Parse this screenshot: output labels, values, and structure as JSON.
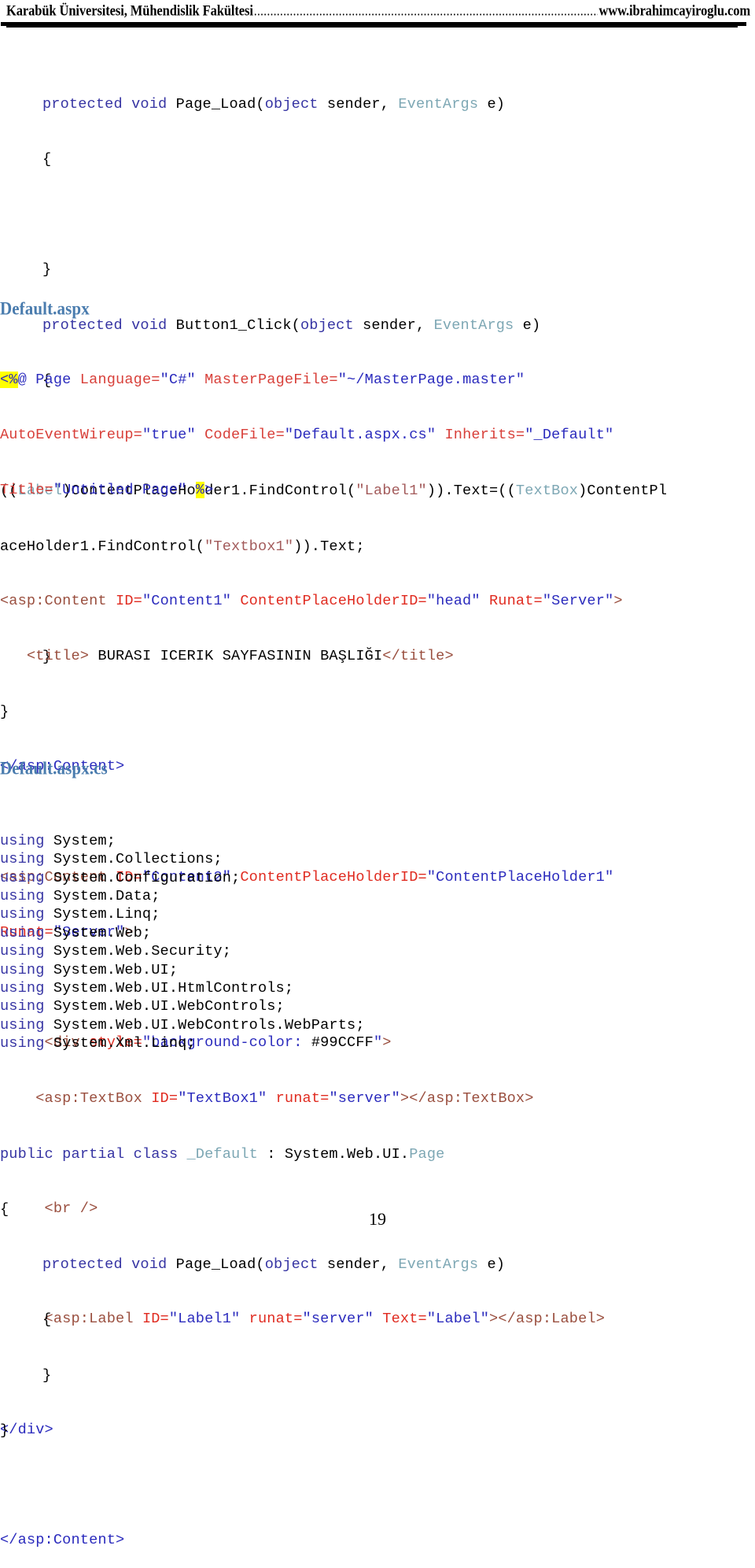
{
  "header": {
    "left": "Karabük Üniversitesi, Mühendislik Fakültesi",
    "dots": "............................................................................................................",
    "right": "www.ibrahimcayiroglu.com"
  },
  "headings": {
    "default_aspx": "Default.aspx",
    "default_aspx_cs": "Default.aspx.cs"
  },
  "code_top": {
    "l1_kw": "protected void",
    "l1_name": " Page_Load(",
    "l1_obj": "object",
    "l1_mid": " sender, ",
    "l1_type": "EventArgs",
    "l1_end": " e)",
    "l2": "{",
    "l3": "}",
    "l4_kw": "protected void",
    "l4_name": " Button1_Click(",
    "l4_obj": "object",
    "l4_mid": " sender, ",
    "l4_type": "EventArgs",
    "l4_end": " e)",
    "l5": "{",
    "stmt_a_open": "((",
    "stmt_a_type": "Label",
    "stmt_a_mid": ")ContentPlaceHolder1.FindControl(",
    "stmt_a_str": "\"Label1\"",
    "stmt_a_mid2": ")).Text=((",
    "stmt_a_type2": "TextBox",
    "stmt_a_tail": ")ContentPl",
    "stmt_b_head": "aceHolder1.FindControl(",
    "stmt_b_str": "\"Textbox1\"",
    "stmt_b_tail": ")).Text;",
    "l8": "}",
    "l9": "}"
  },
  "code_aspx": {
    "d1_open": "<%",
    "d1_at": "@ Page ",
    "d1_a1": "Language=",
    "d1_v1": "\"C#\"",
    "d1_a2": " MasterPageFile=",
    "d1_v2": "\"~/MasterPage.master\"",
    "d2_a1": "AutoEventWireup=",
    "d2_v1": "\"true\"",
    "d2_a2": " CodeFile=",
    "d2_v2": "\"Default.aspx.cs\"",
    "d2_a3": " Inherits=",
    "d2_v3": "\"_Default\"",
    "d3_a1": "Title=",
    "d3_v1": "\"Untitled Page\"",
    "d3_sp": " ",
    "d3_pct": "%",
    "d3_gt": ">",
    "c1_tag": "<asp:Content ",
    "c1_a1": "ID=",
    "c1_v1": "\"Content1\"",
    "c1_a2": " ContentPlaceHolderID=",
    "c1_v2": "\"head\"",
    "c1_a3": " Runat=",
    "c1_v3": "\"Server\"",
    "c1_gt": ">",
    "t1_indent": "   ",
    "t1_open": "<title>",
    "t1_text": " BURASI ICERIK SAYFASININ BAŞLIĞI",
    "t1_close": "</title>",
    "c1_close": "</asp:Content>",
    "c2_tag": "<asp:Content ",
    "c2_a1": "ID=",
    "c2_v1": "\"Content2\"",
    "c2_a2": " ContentPlaceHolderID=",
    "c2_v2": "\"ContentPlaceHolder1\"",
    "c2_a3": "Runat=",
    "c2_v3": "\"Server\"",
    "c2_gt": ">",
    "div_indent": "     ",
    "div_tag": "<div ",
    "div_attr": "style=",
    "div_q1": "\"background-color: ",
    "div_color": "#99CCFF",
    "div_q2": "\"",
    "div_gt": ">",
    "tb_indent": "    ",
    "tb_tag": "<asp:TextBox ",
    "tb_a1": "ID=",
    "tb_v1": "\"TextBox1\"",
    "tb_a2": " runat=",
    "tb_v2": "\"server\"",
    "tb_gt": ">",
    "tb_close": "</asp:TextBox>",
    "br_indent": "     ",
    "br_tag": "<br />",
    "lb_indent": "     ",
    "lb_tag": "<asp:Label ",
    "lb_a1": "ID=",
    "lb_v1": "\"Label1\"",
    "lb_a2": " runat=",
    "lb_v2": "\"server\"",
    "lb_a3": " Text=",
    "lb_v3": "\"Label\"",
    "lb_gt": ">",
    "lb_close": "</asp:Label>",
    "div_close": "</div>",
    "c2_close": "</asp:Content>"
  },
  "code_cs": {
    "usings": [
      "System;",
      "System.Collections;",
      "System.Configuration;",
      "System.Data;",
      "System.Linq;",
      "System.Web;",
      "System.Web.Security;",
      "System.Web.UI;",
      "System.Web.UI.HtmlControls;",
      "System.Web.UI.WebControls;",
      "System.Web.UI.WebControls.WebParts;",
      "System.Xml.Linq;"
    ],
    "using_kw": "using",
    "cls_kw": "public partial class ",
    "cls_name": "_Default",
    "cls_colon": " : System.Web.UI.",
    "cls_base": "Page",
    "brace_open": "{",
    "m_kw": "protected void",
    "m_name": " Page_Load(",
    "m_obj": "object",
    "m_mid": " sender, ",
    "m_type": "EventArgs",
    "m_end": " e)",
    "m_open": "{",
    "m_close": "}",
    "brace_close": "}"
  },
  "footer": {
    "page_number": "19"
  }
}
